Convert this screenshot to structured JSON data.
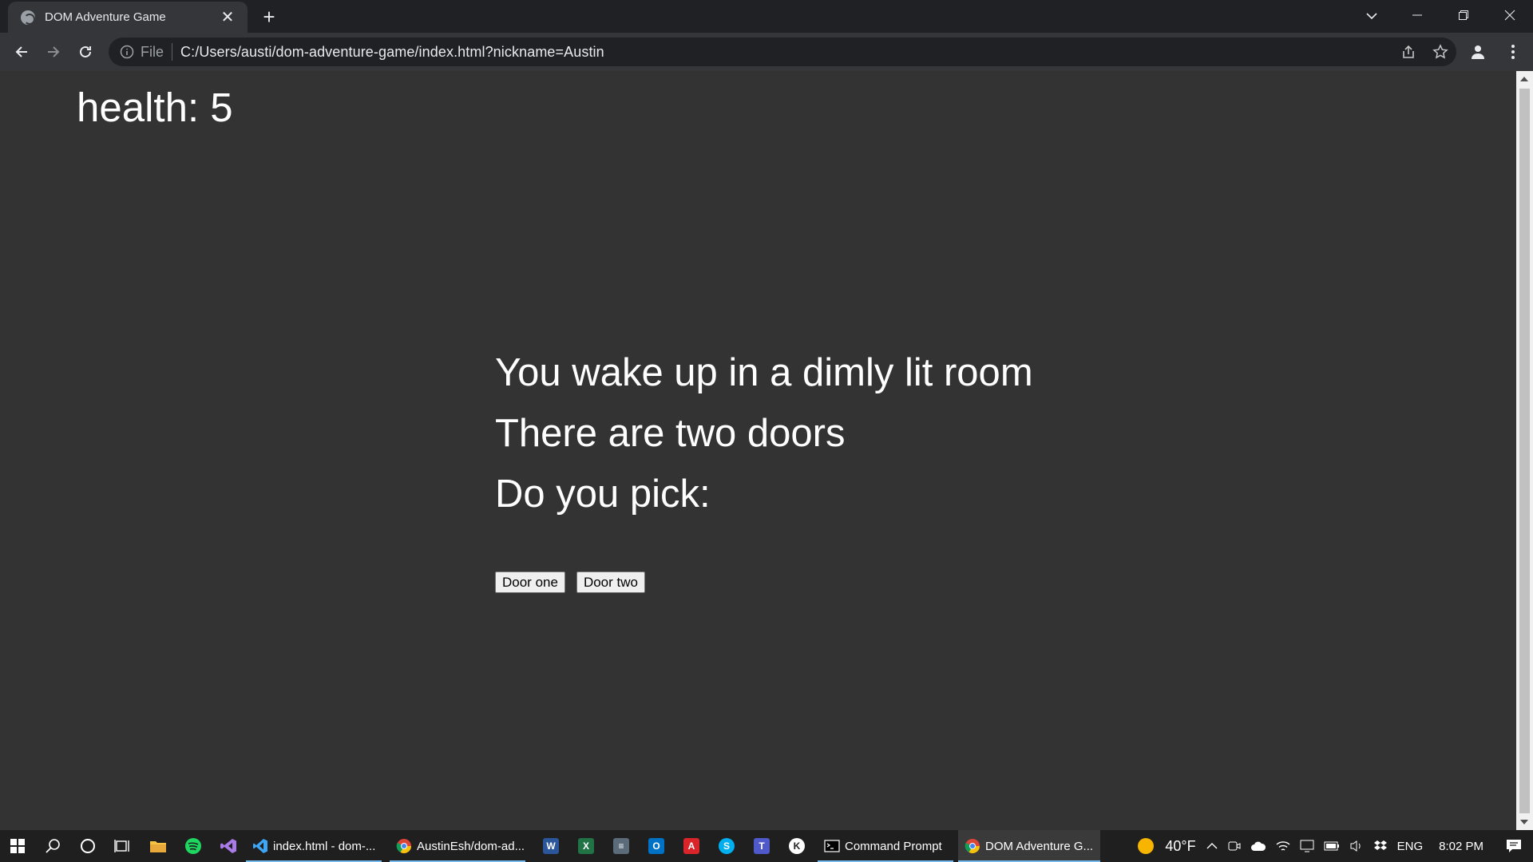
{
  "browser": {
    "tab_title": "DOM Adventure Game",
    "new_tab_label": "+",
    "close_label": "✕",
    "scheme_label": "File",
    "url": "C:/Users/austi/dom-adventure-game/index.html?nickname=Austin"
  },
  "game": {
    "health_label": "health: 5",
    "lines": [
      "You wake up in a dimly lit room",
      "There are two doors",
      "Do you pick:"
    ],
    "choices": [
      "Door one",
      "Door two"
    ]
  },
  "taskbar": {
    "apps": [
      {
        "label": "index.html - dom-...",
        "icon": "vscode-icon"
      },
      {
        "label": "AustinEsh/dom-ad...",
        "icon": "chrome-icon"
      },
      {
        "label": "Command Prompt",
        "icon": "cmd-icon"
      },
      {
        "label": "DOM Adventure G...",
        "icon": "chrome-icon"
      }
    ],
    "temperature": "40°F",
    "language": "ENG",
    "time": "8:02 PM"
  },
  "colors": {
    "page_bg": "#333333",
    "chrome_bg": "#202124",
    "toolbar_bg": "#35363a",
    "taskbar_bg": "#1f1f1f",
    "accent": "#76b9ed"
  }
}
